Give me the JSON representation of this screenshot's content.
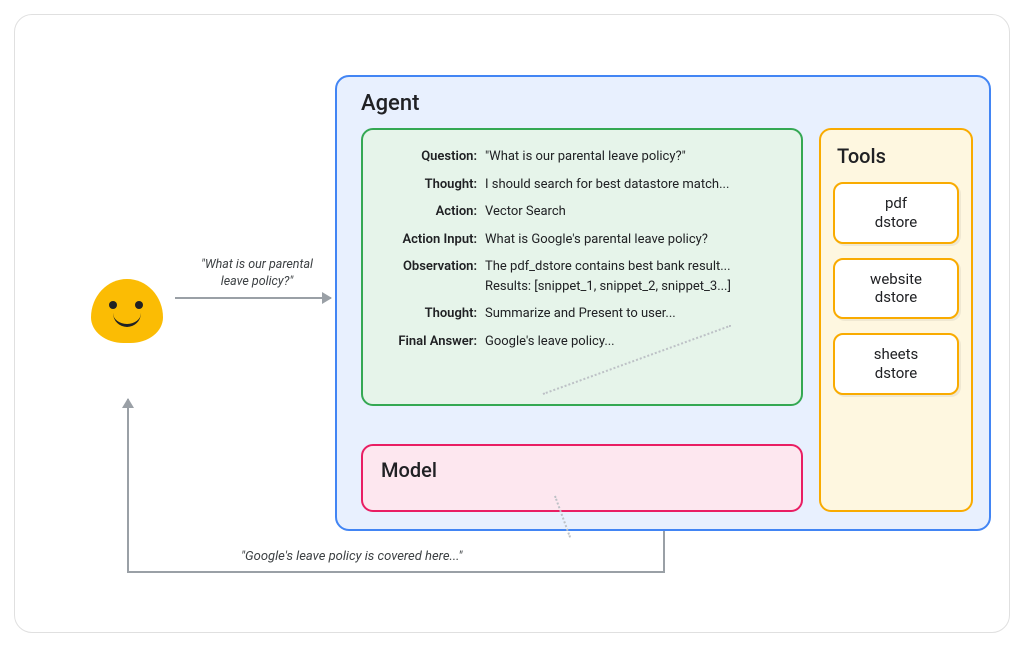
{
  "user": {
    "query": "\"What is our parental leave policy?\""
  },
  "agent": {
    "title": "Agent",
    "reasoning": [
      {
        "label": "Question:",
        "value": "\"What is our parental leave policy?\""
      },
      {
        "label": "Thought:",
        "value": "I should search for best datastore match..."
      },
      {
        "label": "Action:",
        "value": "Vector Search"
      },
      {
        "label": "Action Input:",
        "value": "What is Google's parental leave policy?"
      },
      {
        "label": "Observation:",
        "value": "The pdf_dstore contains best bank result...",
        "value2": "Results: [snippet_1, snippet_2, snippet_3...]"
      },
      {
        "label": "Thought:",
        "value": "Summarize and Present to user..."
      },
      {
        "label": "Final Answer:",
        "value": "Google's leave policy..."
      }
    ],
    "model_title": "Model",
    "tools_title": "Tools",
    "tools": [
      {
        "line1": "pdf",
        "line2": "dstore"
      },
      {
        "line1": "website",
        "line2": "dstore"
      },
      {
        "line1": "sheets",
        "line2": "dstore"
      }
    ]
  },
  "response": "\"Google's leave policy is covered here...\""
}
